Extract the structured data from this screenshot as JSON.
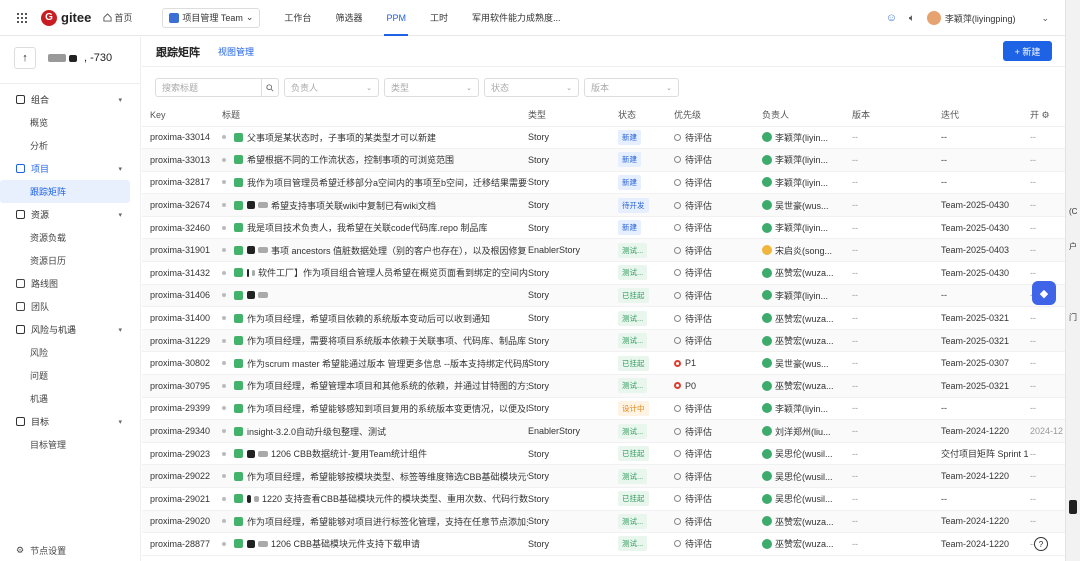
{
  "topnav": {
    "logo_text": "gitee",
    "home_label": "首页",
    "project_select": "项目管理 Team",
    "tabs": [
      "工作台",
      "筛选器",
      "PPM",
      "工时",
      "军用软件能力成熟度..."
    ],
    "active_tab": "PPM",
    "user_name": "李颖萍(liyingping)"
  },
  "sidebar": {
    "project_suffix": "-730",
    "items": [
      {
        "label": "组合",
        "type": "group"
      },
      {
        "label": "概览",
        "type": "sub"
      },
      {
        "label": "分析",
        "type": "sub"
      },
      {
        "label": "项目",
        "type": "group",
        "on": true
      },
      {
        "label": "跟踪矩阵",
        "type": "sub",
        "active": true
      },
      {
        "label": "资源",
        "type": "group"
      },
      {
        "label": "资源负载",
        "type": "sub"
      },
      {
        "label": "资源日历",
        "type": "sub"
      },
      {
        "label": "路线图",
        "type": "single"
      },
      {
        "label": "团队",
        "type": "single"
      },
      {
        "label": "风险与机遇",
        "type": "group"
      },
      {
        "label": "风险",
        "type": "sub"
      },
      {
        "label": "问题",
        "type": "sub"
      },
      {
        "label": "机遇",
        "type": "sub"
      },
      {
        "label": "目标",
        "type": "group"
      },
      {
        "label": "目标管理",
        "type": "sub"
      }
    ],
    "footer_label": "节点设置"
  },
  "main": {
    "title": "跟踪矩阵",
    "tab_view": "视图管理",
    "new_button": "+ 新建",
    "filters": {
      "search_placeholder": "搜索标题",
      "owner": "负责人",
      "type": "类型",
      "status": "状态",
      "version": "版本"
    },
    "columns": [
      "Key",
      "标题",
      "类型",
      "状态",
      "优先级",
      "负责人",
      "版本",
      "迭代",
      "开"
    ],
    "rows": [
      {
        "key": "proxima-33014",
        "title": "父事项是某状态时，子事项的某类型才可以新建",
        "type": "Story",
        "status": "新建",
        "sc": "new",
        "pri": "待评估",
        "owner": "李颖萍(liyin...",
        "version": "--",
        "iter": "--",
        "extra": "--"
      },
      {
        "key": "proxima-33013",
        "title": "希望根据不同的工作流状态，控制事项的可浏览范围",
        "type": "Story",
        "status": "新建",
        "sc": "new",
        "pri": "待评估",
        "owner": "李颖萍(liyin...",
        "version": "--",
        "iter": "--",
        "extra": "--"
      },
      {
        "key": "proxima-32817",
        "title": "我作为项目管理员希望迁移部分a空间内的事项至b空间，迁移结果需要包含",
        "type": "Story",
        "status": "新建",
        "sc": "new",
        "pri": "待评估",
        "owner": "李颖萍(liyin...",
        "version": "--",
        "iter": "--",
        "extra": "--"
      },
      {
        "key": "proxima-32674",
        "title": "希望支持事项关联wiki中复制已有wiki文档",
        "type": "Story",
        "status": "待开发",
        "sc": "dev",
        "pri": "待评估",
        "owner": "吴世豪(wus...",
        "version": "--",
        "iter": "Team-2025-0430",
        "extra": "--",
        "blur": true
      },
      {
        "key": "proxima-32460",
        "title": "我是项目技术负责人，我希望在关联code代码库.repo 制品库",
        "type": "Story",
        "status": "新建",
        "sc": "new",
        "pri": "待评估",
        "owner": "李颖萍(liyin...",
        "version": "--",
        "iter": "Team-2025-0430",
        "extra": "--"
      },
      {
        "key": "proxima-31901",
        "title": "事项 ancestors 值脏数据处理（别的客户也存在），以及根因修复",
        "type": "EnablerStory",
        "status": "测试...",
        "sc": "test",
        "pri": "待评估",
        "owner": "宋启炎(song...",
        "oy": true,
        "version": "--",
        "iter": "Team-2025-0403",
        "extra": "--",
        "blur": true
      },
      {
        "key": "proxima-31432",
        "title": "软件工厂】作为项目组合管理人员希望在概览页面看到绑定的空间内",
        "type": "Story",
        "status": "测试...",
        "sc": "test",
        "pri": "待评估",
        "owner": "巫赞宏(wuza...",
        "version": "--",
        "iter": "Team-2025-0430",
        "extra": "--",
        "blur": true
      },
      {
        "key": "proxima-31406",
        "title": "",
        "type": "Story",
        "status": "已挂起",
        "sc": "done",
        "pri": "待评估",
        "owner": "李颖萍(liyin...",
        "version": "--",
        "iter": "--",
        "extra": "--",
        "blur": true
      },
      {
        "key": "proxima-31400",
        "title": "作为项目经理，希望项目依赖的系统版本变动后可以收到通知",
        "type": "Story",
        "status": "测试...",
        "sc": "test",
        "pri": "待评估",
        "owner": "巫赞宏(wuza...",
        "version": "--",
        "iter": "Team-2025-0321",
        "extra": "--"
      },
      {
        "key": "proxima-31229",
        "title": "作为项目经理，需要将项目系统版本依赖于关联事项、代码库、制品库",
        "type": "Story",
        "status": "测试...",
        "sc": "test",
        "pri": "待评估",
        "owner": "巫赞宏(wuza...",
        "version": "--",
        "iter": "Team-2025-0321",
        "extra": "--"
      },
      {
        "key": "proxima-30802",
        "title": "作为scrum master 希望能通过版本 管理更多信息 --版本支持绑定代码库分支",
        "type": "Story",
        "status": "已挂起",
        "sc": "done",
        "pri": "P1",
        "pri_red": true,
        "owner": "吴世豪(wus...",
        "version": "--",
        "iter": "Team-2025-0307",
        "extra": "--"
      },
      {
        "key": "proxima-30795",
        "title": "作为项目经理，希望管理本项目和其他系统的依赖，并通过甘特图的方式查看",
        "type": "Story",
        "status": "测试...",
        "sc": "test",
        "pri": "P0",
        "pri_red": true,
        "owner": "巫赞宏(wuza...",
        "version": "--",
        "iter": "Team-2025-0321",
        "extra": "--"
      },
      {
        "key": "proxima-29399",
        "title": "作为项目经理，希望能够感知到项目复用的系统版本变更情况，以便及时",
        "type": "Story",
        "status": "设计中",
        "sc": "design",
        "pri": "待评估",
        "owner": "李颖萍(liyin...",
        "version": "--",
        "iter": "--",
        "extra": "--"
      },
      {
        "key": "proxima-29340",
        "title": "insight-3.2.0自动升级包整理、测试",
        "type": "EnablerStory",
        "status": "测试...",
        "sc": "test",
        "pri": "待评估",
        "owner": "刘洋郑州(liu...",
        "version": "--",
        "iter": "Team-2024-1220",
        "extra": "2024-12"
      },
      {
        "key": "proxima-29023",
        "title": "1206 CBB数据统计-复用Team统计组件",
        "type": "Story",
        "status": "已挂起",
        "sc": "done",
        "pri": "待评估",
        "owner": "吴思伦(wusil...",
        "version": "--",
        "iter": "交付项目矩阵 Sprint 1",
        "extra": "--",
        "blur": true
      },
      {
        "key": "proxima-29022",
        "title": "作为项目经理，希望能够按模块类型、标签等维度筛选CBB基础模块元件，",
        "type": "Story",
        "status": "测试...",
        "sc": "test",
        "pri": "待评估",
        "owner": "吴思伦(wusil...",
        "version": "--",
        "iter": "Team-2024-1220",
        "extra": "--"
      },
      {
        "key": "proxima-29021",
        "title": "1220 支持查看CBB基础模块元件的模块类型、重用次数、代码行数",
        "type": "Story",
        "status": "已挂起",
        "sc": "done",
        "pri": "待评估",
        "owner": "吴思伦(wusil...",
        "version": "--",
        "iter": "--",
        "extra": "--",
        "blur": true
      },
      {
        "key": "proxima-29020",
        "title": "作为项目经理，希望能够对项目进行标签化管理，支持在任意节点添加多个",
        "type": "Story",
        "status": "测试...",
        "sc": "test",
        "pri": "待评估",
        "owner": "巫赞宏(wuza...",
        "version": "--",
        "iter": "Team-2024-1220",
        "extra": "--"
      },
      {
        "key": "proxima-28877",
        "title": "1206 CBB基础模块元件支持下载申请",
        "type": "Story",
        "status": "测试...",
        "sc": "test",
        "pri": "待评估",
        "owner": "巫赞宏(wuza...",
        "version": "--",
        "iter": "Team-2024-1220",
        "extra": "--",
        "blur": true
      }
    ]
  },
  "rstrip": [
    "(C",
    "户",
    "门"
  ]
}
